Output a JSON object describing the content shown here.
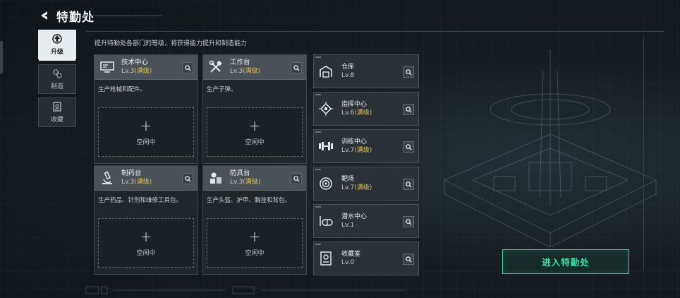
{
  "header": {
    "title": "特勤处"
  },
  "subtitle": "提升特勤处各部门的等级，将获得能力提升和制造能力",
  "tabs": [
    {
      "label": "升级",
      "icon": "upgrade-icon",
      "active": true
    },
    {
      "label": "制造",
      "icon": "gears-icon",
      "active": false
    },
    {
      "label": "收藏",
      "icon": "collection-icon",
      "active": false
    }
  ],
  "workstations": [
    {
      "name": "技术中心",
      "level": "Lv.3",
      "max": "(满级)",
      "desc": "生产枪械和配件。",
      "slot": "空闲中",
      "icon": "computer-icon"
    },
    {
      "name": "工作台",
      "level": "Lv.3",
      "max": "(满级)",
      "desc": "生产子弹。",
      "slot": "空闲中",
      "icon": "tools-icon"
    },
    {
      "name": "制药台",
      "level": "Lv.3",
      "max": "(满级)",
      "desc": "生产药品、针剂和维修工具包。",
      "slot": "空闲中",
      "icon": "microscope-icon"
    },
    {
      "name": "防具台",
      "level": "Lv.3",
      "max": "(满级)",
      "desc": "生产头盔、护甲、胸挂和背包。",
      "slot": "空闲中",
      "icon": "armor-blocks-icon"
    }
  ],
  "facilities": [
    {
      "name": "仓库",
      "level": "Lv.8",
      "max": "",
      "icon": "warehouse-icon"
    },
    {
      "name": "指挥中心",
      "level": "Lv.6",
      "max": "(满级)",
      "icon": "chip-icon"
    },
    {
      "name": "训练中心",
      "level": "Lv.7",
      "max": "(满级)",
      "icon": "dumbbell-icon"
    },
    {
      "name": "靶场",
      "level": "Lv.7",
      "max": "(满级)",
      "icon": "target-icon"
    },
    {
      "name": "潜水中心",
      "level": "Lv.1",
      "max": "",
      "icon": "diving-icon"
    },
    {
      "name": "收藏室",
      "level": "Lv.0",
      "max": "",
      "icon": "trophy-icon"
    }
  ],
  "enter_button": "进入特勤处",
  "colors": {
    "accent_green": "#3fe0a4",
    "max_level_gold": "#e8c14a",
    "active_tab": "#e9ecee"
  }
}
